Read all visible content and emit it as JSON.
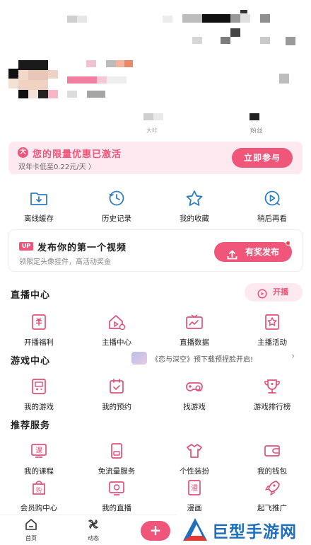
{
  "promo": {
    "badge": "大",
    "title": "您的限量优惠已激活",
    "subtitle": "双年卡低至0.22元/天 〉",
    "button": "立即参与"
  },
  "quick_actions": [
    {
      "label": "离线缓存",
      "icon": "offline-cache-icon"
    },
    {
      "label": "历史记录",
      "icon": "history-icon"
    },
    {
      "label": "我的收藏",
      "icon": "favorites-star-icon"
    },
    {
      "label": "稍后再看",
      "icon": "watch-later-icon"
    }
  ],
  "upload": {
    "badge": "UP",
    "title": "发布你的第一个视频",
    "subtitle": "领限定头像挂件，高活动奖金",
    "button": "有奖发布"
  },
  "live_center": {
    "title": "直播中心",
    "button": "开播",
    "items": [
      {
        "label": "开播福利",
        "icon": "live-bonus-icon"
      },
      {
        "label": "主播中心",
        "icon": "streamer-center-icon"
      },
      {
        "label": "直播数据",
        "icon": "live-data-icon"
      },
      {
        "label": "主播活动",
        "icon": "streamer-events-icon"
      }
    ]
  },
  "game_center": {
    "title": "游戏中心",
    "banner": "《恋与深空》预下载预捏脸开启!",
    "items": [
      {
        "label": "我的游戏",
        "icon": "my-games-icon"
      },
      {
        "label": "我的预约",
        "icon": "my-reservations-icon"
      },
      {
        "label": "找游戏",
        "icon": "find-games-icon"
      },
      {
        "label": "游戏排行榜",
        "icon": "game-ranking-icon"
      }
    ]
  },
  "services": {
    "title": "推荐服务",
    "row1": [
      {
        "label": "我的课程",
        "icon": "my-courses-icon"
      },
      {
        "label": "免流量服务",
        "icon": "free-data-icon"
      },
      {
        "label": "个性装扮",
        "icon": "dress-up-icon"
      },
      {
        "label": "我的钱包",
        "icon": "wallet-icon"
      }
    ],
    "row2": [
      {
        "label": "会员购中心",
        "icon": "member-shop-icon"
      },
      {
        "label": "我的直播",
        "icon": "my-live-icon"
      },
      {
        "label": "漫画",
        "icon": "comics-icon"
      },
      {
        "label": "起飞推广",
        "icon": "promotion-rocket-icon"
      }
    ]
  },
  "profile": {
    "stat_label_1": "大咔",
    "stat_label_2": "粉丝"
  },
  "bottom_nav": {
    "home": "首页",
    "dynamic": "动态",
    "plus": "+"
  },
  "watermark": "巨型手游网",
  "colors": {
    "accent": "#f0557a",
    "accent_light": "#fde9ef",
    "watermark": "#1f6fbf"
  }
}
